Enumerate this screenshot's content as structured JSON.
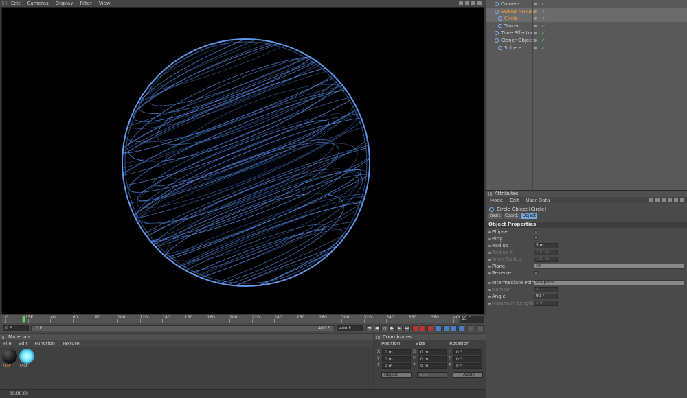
{
  "menu": [
    "Edit",
    "Cameras",
    "Display",
    "Filter",
    "View"
  ],
  "timeline": {
    "ticks": [
      "0",
      "20",
      "40",
      "60",
      "80",
      "100",
      "120",
      "140",
      "160",
      "180",
      "200",
      "220",
      "240",
      "260",
      "280",
      "300",
      "320",
      "340",
      "360",
      "380",
      "400"
    ],
    "current_frame": "15F",
    "current_frame_box": "15 F",
    "start_field": "0 F",
    "range_start": "0 F",
    "range_end": "400 F",
    "end_field": "400 F"
  },
  "materials": {
    "title": "Materials",
    "menu": [
      "File",
      "Edit",
      "Function",
      "Texture"
    ],
    "items": [
      {
        "label": "Mat",
        "color": "#1e1e1e"
      },
      {
        "label": "Mat",
        "color": "#6fe6ff"
      }
    ]
  },
  "coordinates": {
    "title": "Coordinates",
    "headers": [
      "Position",
      "Size",
      "Rotation"
    ],
    "rows": [
      {
        "axis": "X",
        "pos": "0 m",
        "saxis": "X",
        "size": "0 m",
        "raxis": "H",
        "rot": "0 °"
      },
      {
        "axis": "Y",
        "pos": "0 m",
        "saxis": "Y",
        "size": "0 m",
        "raxis": "P",
        "rot": "0 °"
      },
      {
        "axis": "Z",
        "pos": "0 m",
        "saxis": "Z",
        "size": "0 m",
        "raxis": "B",
        "rot": "0 °"
      }
    ],
    "mode": "Object",
    "size_mode": "Size",
    "apply": "Apply"
  },
  "status": "00:00:00",
  "objects": [
    {
      "name": "Camera",
      "selected": false
    },
    {
      "name": "Sweep NURBS",
      "selected": true
    },
    {
      "name": "Circle",
      "selected": true
    },
    {
      "name": "Tracer",
      "selected": false
    },
    {
      "name": "Time Effector",
      "selected": false
    },
    {
      "name": "Cloner Object",
      "selected": false
    },
    {
      "name": "Sphere",
      "selected": false
    }
  ],
  "attributes": {
    "title": "Attributes",
    "menu": [
      "Mode",
      "Edit",
      "User Data"
    ],
    "object_title": "Circle Object [Circle]",
    "tabs": [
      "Basic",
      "Coord.",
      "Object"
    ],
    "active_tab": "Object",
    "section": "Object Properties",
    "props": [
      {
        "label": "Ellipse",
        "type": "check",
        "dim": false
      },
      {
        "label": "Ring",
        "type": "check",
        "dim": false
      },
      {
        "label": "Radius",
        "type": "value",
        "value": "5 m",
        "dim": false
      },
      {
        "label": "Radius Y",
        "type": "value",
        "value": "200 m",
        "dim": true
      },
      {
        "label": "Inner Radius",
        "type": "value",
        "value": "100 m",
        "dim": true
      },
      {
        "label": "Plane",
        "type": "drop",
        "value": "XY",
        "dim": false
      },
      {
        "label": "Reverse",
        "type": "check",
        "dim": false
      },
      {
        "label": "Intermediate Points",
        "type": "drop",
        "value": "Adaptive",
        "dim": false
      },
      {
        "label": "Number",
        "type": "value",
        "value": "8",
        "dim": true
      },
      {
        "label": "Angle",
        "type": "value",
        "value": "90 °",
        "dim": false
      },
      {
        "label": "Maximum Length",
        "type": "value",
        "value": "5 m",
        "dim": true
      }
    ]
  },
  "colors": {
    "accent_blue": "#6aa8ff",
    "selection_orange": "#f0a040",
    "active_green": "#6bd36b"
  }
}
